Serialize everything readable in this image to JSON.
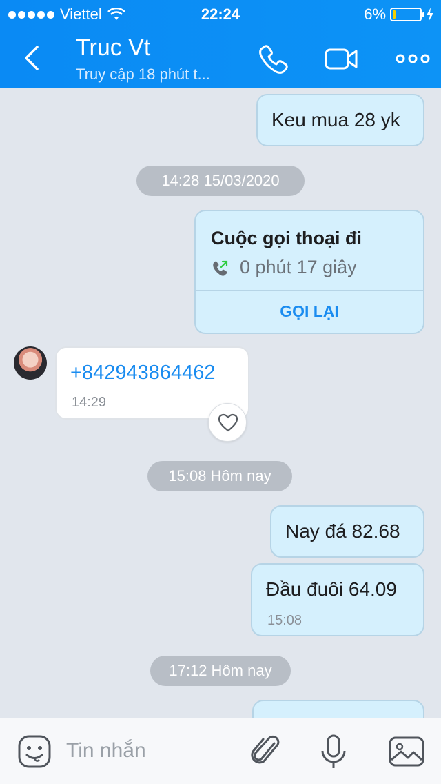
{
  "status_bar": {
    "carrier": "Viettel",
    "time": "22:24",
    "battery": "6%"
  },
  "header": {
    "title": "Truc Vt",
    "subtitle": "Truy cập 18 phút t...",
    "icons": [
      "back-chevron-icon",
      "phone-icon",
      "video-icon",
      "more-icon"
    ]
  },
  "messages": {
    "m1": {
      "text": "Keu mua 28 yk"
    },
    "ts1": "14:28 15/03/2020",
    "call": {
      "title": "Cuộc gọi thoại đi",
      "duration": "0 phút 17 giây",
      "action": "GỌI LẠI"
    },
    "incoming": {
      "text": "+842943864462",
      "time": "14:29"
    },
    "ts2": "15:08 Hôm nay",
    "m2": {
      "text": "Nay đá 82.68"
    },
    "m3": {
      "text": "Đầu đuôi 64.09",
      "time": "15:08"
    },
    "ts3": "17:12 Hôm nay"
  },
  "composer": {
    "placeholder": "Tin nhắn",
    "icons": [
      "emoji-icon",
      "attachment-icon",
      "microphone-icon",
      "image-icon"
    ]
  },
  "colors": {
    "header": "#0a8af4",
    "outgoing_bubble": "#d5f0fd",
    "link": "#1a8cf0",
    "background": "#e1e6ed"
  }
}
